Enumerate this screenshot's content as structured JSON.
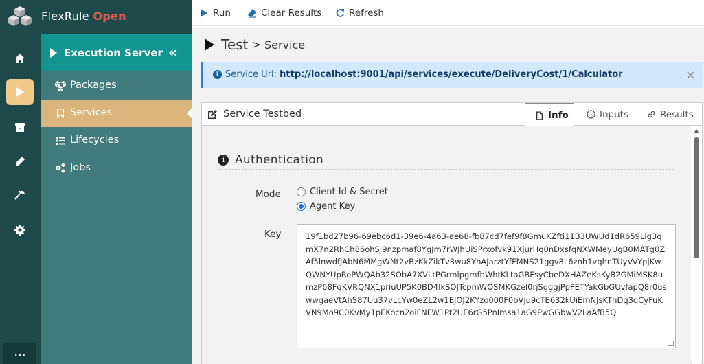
{
  "app": {
    "name": "FlexRule",
    "edition": "Open"
  },
  "rail": {
    "more_label": "..."
  },
  "sidebar": {
    "title": "Execution Server",
    "collapse_glyph": "«",
    "items": [
      {
        "label": "Packages",
        "icon": "cubes-icon"
      },
      {
        "label": "Services",
        "icon": "bookmark-icon"
      },
      {
        "label": "Lifecycles",
        "icon": "list-icon"
      },
      {
        "label": "Jobs",
        "icon": "gears-icon"
      }
    ]
  },
  "toolbar": {
    "run_label": "Run",
    "clear_label": "Clear Results",
    "refresh_label": "Refresh"
  },
  "breadcrumb": {
    "root": "Test",
    "separator": ">",
    "current": "Service"
  },
  "alert": {
    "prefix": "Service Url: ",
    "url": "http://localhost:9001/api/services/execute/DeliveryCost/1/Calculator",
    "close": "×"
  },
  "panel": {
    "title": "Service Testbed",
    "tabs": [
      {
        "label": "Info"
      },
      {
        "label": "Inputs"
      },
      {
        "label": "Results"
      }
    ]
  },
  "auth": {
    "section_title": "Authentication",
    "mode_label": "Mode",
    "mode_options": [
      "Client Id & Secret",
      "Agent Key"
    ],
    "selected_mode": "Agent Key",
    "key_label": "Key",
    "key_value": "19f1bd27b96-69ebc6d1-39e6-4a63-ae68-fb87cd7fef9f8GmuKZfti11B3UWUd1dR659Lig3qmX7n2RhCh86ohSJ9nzpmaf8YgJm7rWJhUiSPrxofvk91XjurHq0nDxsfqNXWMeyUgB0MATg0ZAf5lnwdfJAbN6MMgWNt2vBzKkZikTv3wu8YhAJarztYfFMNS21ggv8L6znh1vqhnTUyVvYpjKwQWNYUpRoPWQAb32SObA7XVLtPGrmlpgmfbWhtKLtaGBFsyCbeDXHAZeKsKyB2GMiMSK8umzP68FqKVRQNX1priuUP5K0BD4IkSOJTcpmWOSMKGzel0rjSgggjPpFETYakGbGUvfapQ8r0uswwgaeVtAhS87Uu37vLcYw0eZL2w1EJOJ2KYzo000F0bVju9cTE632kUiEmNJsKTnDq3qCyFuKVN9Mo9C0KvMy1pEKocn2oiFNFW1Pt2UE6rG5PnImsa1aG9PwGGbwV2LaAfB5Q"
  },
  "colors": {
    "rail": "#1e4a4c",
    "sidebar": "#417b7d",
    "sidebar_header": "#129490",
    "active_item": "#dcb57c",
    "edition": "#e55a4f",
    "alert_bg": "#d3e8fb"
  }
}
